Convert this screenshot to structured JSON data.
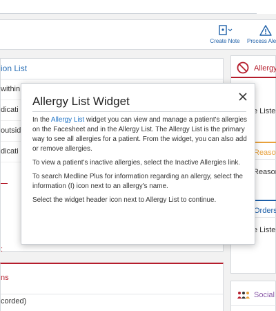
{
  "toolbar": {
    "create_note_label": "Create Note",
    "process_alerts_label": "Process Ale",
    "note_icon": "note-icon",
    "alert_icon": "warning-icon"
  },
  "left_panel": {
    "title": "ion List",
    "rows": [
      "within",
      "dicati",
      "outside",
      "dicati"
    ]
  },
  "left_panel_2": {
    "title": "ns",
    "row": "corded)"
  },
  "right_panel": {
    "allergy_title": "Allergy",
    "allergy_row": "e Liste",
    "reason_title": "Reaso",
    "reason_row": "Reason",
    "orders_title": "Orders",
    "orders_row": "e Liste"
  },
  "right_panel_2": {
    "title": "Social"
  },
  "popover": {
    "title": "Allergy List Widget",
    "p1_before": "In the ",
    "p1_link": "Allergy List",
    "p1_after": " widget you can view and manage a patient's allergies on the Facesheet and in the Allergy List. The Allergy List is the primary way to see all allergies for a patient. From the widget, you can also add or remove allergies.",
    "p2": "To view a patient's inactive allergies, select the Inactive Allergies link.",
    "p3": "To search Medline Plus for information regarding an allergy, select the information (I) icon next to an allergy's name.",
    "p4": "Select the widget header icon next to Allergy List to continue."
  },
  "colors": {
    "accent_blue": "#1d5fa8",
    "allergy_red": "#b51d2c",
    "reason_orange": "#e8a13b",
    "social_purple": "#8a5aa8"
  }
}
